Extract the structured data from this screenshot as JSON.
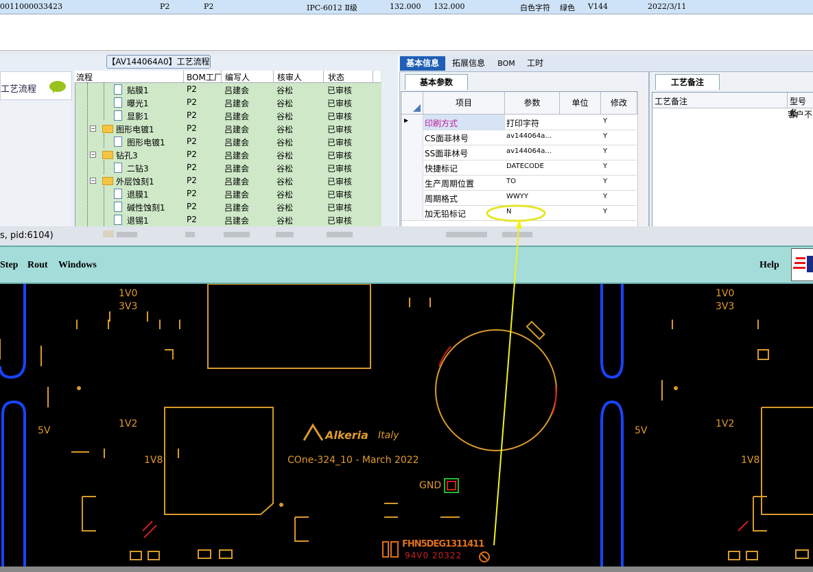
{
  "top_row": {
    "cells": [
      "0011000033423",
      "P2",
      "P2",
      "IPC-6012 Ⅱ级",
      "132.000",
      "132.000",
      "白色字符",
      "绿色",
      "V144",
      "2022/3/11"
    ]
  },
  "flow_panel": {
    "title": "【AV144064A0】工艺流程",
    "side_label": "工艺流程",
    "columns": [
      "流程",
      "BOM工厂",
      "编写人",
      "核审人",
      "状态"
    ],
    "rows": [
      {
        "name": "贴膜1",
        "bom": "P2",
        "writer": "吕建会",
        "reviewer": "谷松",
        "status": "已审核"
      },
      {
        "name": "曝光1",
        "bom": "P2",
        "writer": "吕建会",
        "reviewer": "谷松",
        "status": "已审核"
      },
      {
        "name": "显影1",
        "bom": "P2",
        "writer": "吕建会",
        "reviewer": "谷松",
        "status": "已审核"
      },
      {
        "name": "图形电镀1",
        "bom": "P2",
        "writer": "吕建会",
        "reviewer": "谷松",
        "status": "已审核"
      },
      {
        "name": "图形电镀1",
        "bom": "P2",
        "writer": "吕建会",
        "reviewer": "谷松",
        "status": "已审核"
      },
      {
        "name": "钻孔3",
        "bom": "P2",
        "writer": "吕建会",
        "reviewer": "谷松",
        "status": "已审核"
      },
      {
        "name": "二钻3",
        "bom": "P2",
        "writer": "吕建会",
        "reviewer": "谷松",
        "status": "已审核"
      },
      {
        "name": "外层蚀刻1",
        "bom": "P2",
        "writer": "吕建会",
        "reviewer": "谷松",
        "status": "已审核"
      },
      {
        "name": "退膜1",
        "bom": "P2",
        "writer": "吕建会",
        "reviewer": "谷松",
        "status": "已审核"
      },
      {
        "name": "碱性蚀刻1",
        "bom": "P2",
        "writer": "吕建会",
        "reviewer": "谷松",
        "status": "已审核"
      },
      {
        "name": "退锡1",
        "bom": "P2",
        "writer": "吕建会",
        "reviewer": "谷松",
        "status": "已审核"
      }
    ]
  },
  "right_tabs": [
    "基本信息",
    "拓展信息",
    "BOM",
    "工时"
  ],
  "basic_params": {
    "tab": "基本参数",
    "columns": [
      "项目",
      "参数",
      "单位",
      "修改"
    ],
    "rows": [
      {
        "item": "印刷方式",
        "value": "打印字符",
        "unit": "",
        "mod": "Y"
      },
      {
        "item": "CS面菲林号",
        "value": "av144064a...",
        "unit": "",
        "mod": "Y"
      },
      {
        "item": "SS面菲林号",
        "value": "av144064a...",
        "unit": "",
        "mod": "Y"
      },
      {
        "item": "快捷标记",
        "value": "DATECODE",
        "unit": "",
        "mod": "Y"
      },
      {
        "item": "生产周期位置",
        "value": "TO",
        "unit": "",
        "mod": "Y"
      },
      {
        "item": "周期格式",
        "value": "WWYY",
        "unit": "",
        "mod": "Y"
      },
      {
        "item": "加无铅标记",
        "value": "N",
        "unit": "",
        "mod": "Y"
      }
    ]
  },
  "process_notes": {
    "tab": "工艺备注",
    "columns": [
      "工艺备注",
      "型号备"
    ],
    "cell": "客户不"
  },
  "status_text": "s, pid:6104)",
  "cad_menu": {
    "items": [
      "Step",
      "Rout",
      "Windows"
    ],
    "help": "Help"
  },
  "pcb": {
    "labels_left": [
      "1V0",
      "3V3",
      "1V2",
      "5V",
      "1V8"
    ],
    "labels_right": [
      "1V0",
      "3V3",
      "1V2",
      "5V",
      "1V8"
    ],
    "brand": "Alkeria",
    "brand_sub": "Italy",
    "board_text": "COne-324_10 - March 2022",
    "gnd": "GND",
    "bottom_mark": "FHN5DEG1311411",
    "bottom_mark2": "94V0 20322"
  }
}
